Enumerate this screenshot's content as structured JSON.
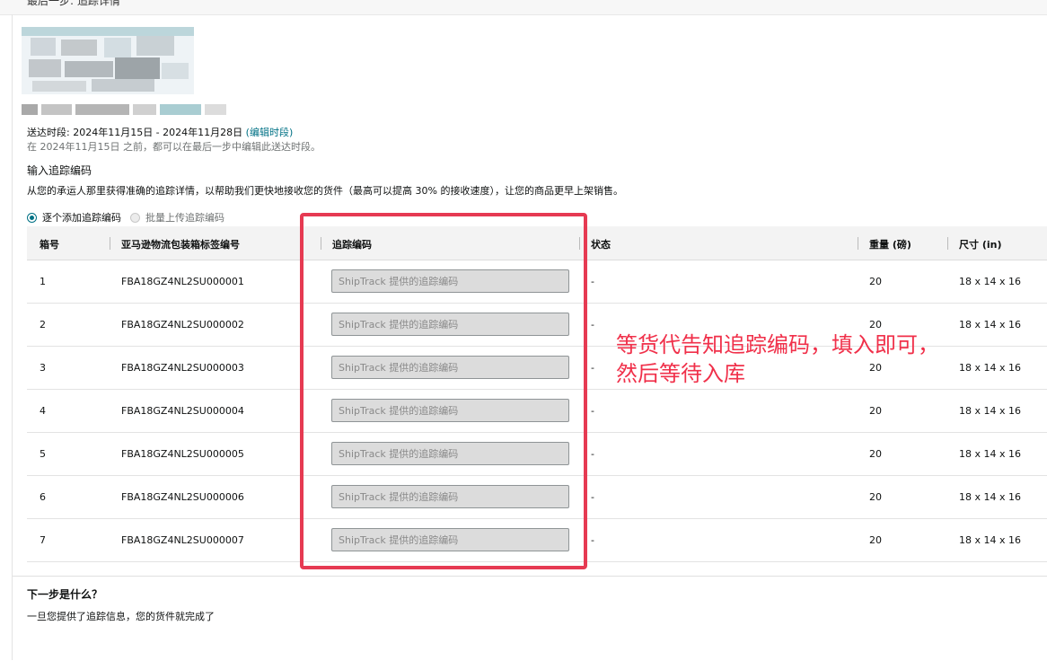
{
  "header": {
    "step_title": "最后一步: 追踪详情"
  },
  "delivery": {
    "window_label": "送达时段: 2024年11月15日 - 2024年11月28日",
    "edit_link": "(编辑时段)",
    "edit_note": "在 2024年11月15日 之前，都可以在最后一步中编辑此送达时段。"
  },
  "tracking": {
    "heading": "输入追踪编码",
    "description": "从您的承运人那里获得准确的追踪详情，以帮助我们更快地接收您的货件（最高可以提高 30% 的接收速度），让您的商品更早上架销售。",
    "mode_one_by_one": "逐个添加追踪编码",
    "mode_bulk_upload": "批量上传追踪编码",
    "selected_mode": "逐个添加追踪编码"
  },
  "table": {
    "headers": [
      "箱号",
      "亚马逊物流包装箱标签编号",
      "追踪编码",
      "状态",
      "重量 (磅)",
      "尺寸 (in)"
    ],
    "input_placeholder": "ShipTrack 提供的追踪编码",
    "rows": [
      {
        "box": "1",
        "label": "FBA18GZ4NL2SU000001",
        "status": "-",
        "weight": "20",
        "dims": "18 x 14 x 16"
      },
      {
        "box": "2",
        "label": "FBA18GZ4NL2SU000002",
        "status": "-",
        "weight": "20",
        "dims": "18 x 14 x 16"
      },
      {
        "box": "3",
        "label": "FBA18GZ4NL2SU000003",
        "status": "-",
        "weight": "20",
        "dims": "18 x 14 x 16"
      },
      {
        "box": "4",
        "label": "FBA18GZ4NL2SU000004",
        "status": "-",
        "weight": "20",
        "dims": "18 x 14 x 16"
      },
      {
        "box": "5",
        "label": "FBA18GZ4NL2SU000005",
        "status": "-",
        "weight": "20",
        "dims": "18 x 14 x 16"
      },
      {
        "box": "6",
        "label": "FBA18GZ4NL2SU000006",
        "status": "-",
        "weight": "20",
        "dims": "18 x 14 x 16"
      },
      {
        "box": "7",
        "label": "FBA18GZ4NL2SU000007",
        "status": "-",
        "weight": "20",
        "dims": "18 x 14 x 16"
      }
    ]
  },
  "annotation": {
    "line1": "等货代告知追踪编码，填入即可，",
    "line2": "然后等待入库",
    "color": "#f0304a"
  },
  "next_steps": {
    "title": "下一步是什么？",
    "description": "一旦您提供了追踪信息，您的货件就完成了"
  },
  "colors": {
    "link": "#007185",
    "highlight_border": "#e63a52",
    "table_header_bg": "#f3f3f3"
  }
}
